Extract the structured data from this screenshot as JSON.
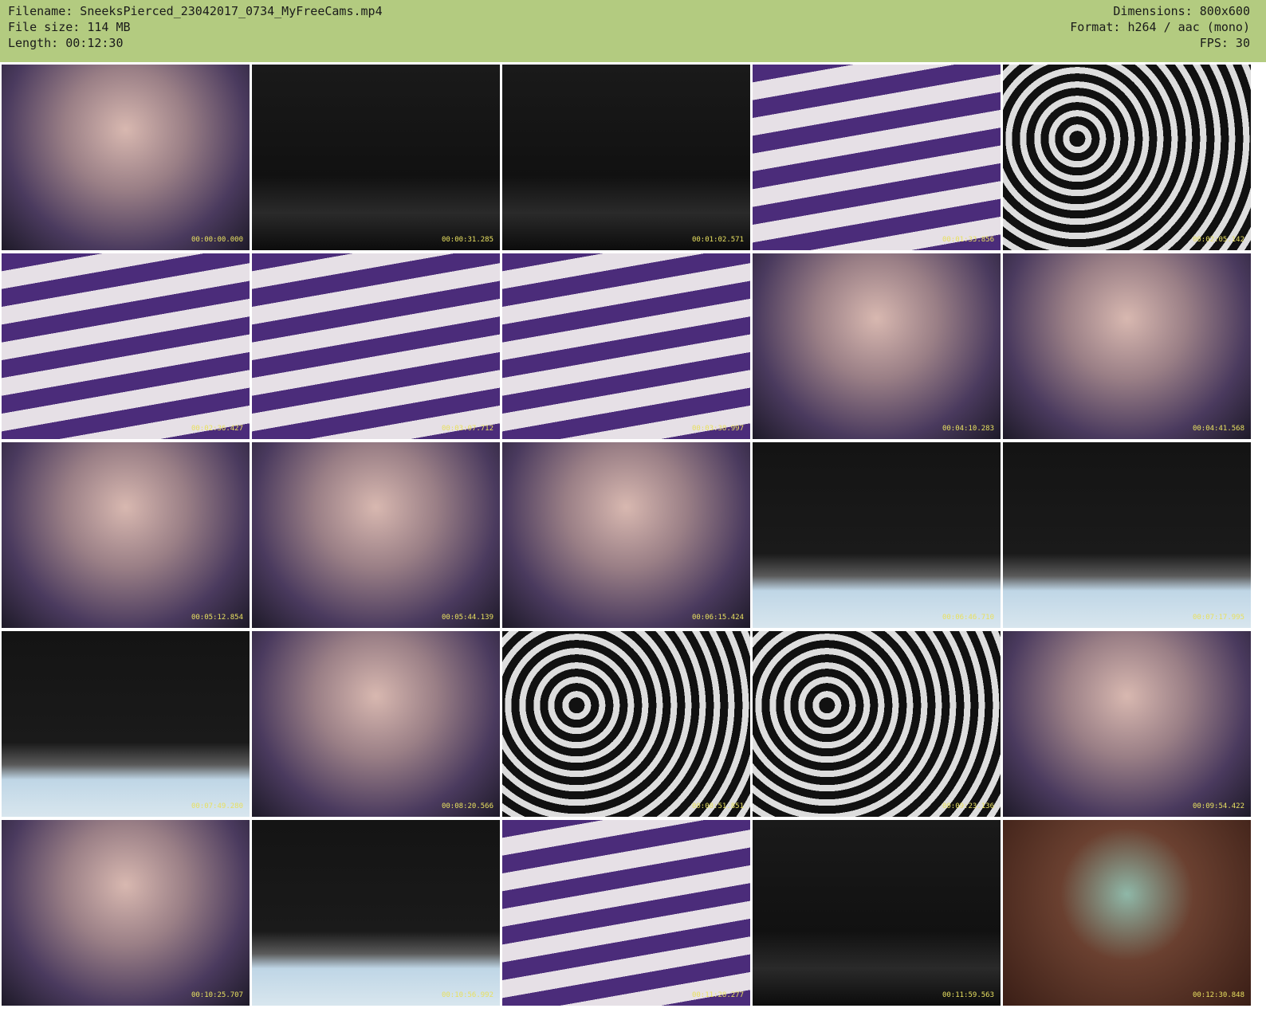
{
  "header": {
    "filename_label": "Filename: SneeksPierced_23042017_0734_MyFreeCams.mp4",
    "filesize_label": "File size: 114 MB",
    "length_label": "Length: 00:12:30",
    "dimensions_label": "Dimensions: 800x600",
    "format_label": "Format: h264 / aac (mono)",
    "fps_label": "FPS: 30"
  },
  "colors": {
    "header_bg": "#b3cb80",
    "timestamp": "#e8e060"
  },
  "thumbnails": [
    {
      "time": "00:00:00.000",
      "style": "warm"
    },
    {
      "time": "00:00:31.285",
      "style": "dark"
    },
    {
      "time": "00:01:02.571",
      "style": "dark"
    },
    {
      "time": "00:01:33.856",
      "style": "stripe"
    },
    {
      "time": "00:02:05.142",
      "style": "pattern"
    },
    {
      "time": "00:02:36.427",
      "style": "stripe"
    },
    {
      "time": "00:03:07.712",
      "style": "stripe"
    },
    {
      "time": "00:03:38.997",
      "style": "stripe"
    },
    {
      "time": "00:04:10.283",
      "style": "warm"
    },
    {
      "time": "00:04:41.568",
      "style": "warm"
    },
    {
      "time": "00:05:12.854",
      "style": "warm"
    },
    {
      "time": "00:05:44.139",
      "style": "warm"
    },
    {
      "time": "00:06:15.424",
      "style": "warm"
    },
    {
      "time": "00:06:46.710",
      "style": "light"
    },
    {
      "time": "00:07:17.995",
      "style": "light"
    },
    {
      "time": "00:07:49.280",
      "style": "light"
    },
    {
      "time": "00:08:20.566",
      "style": "warm"
    },
    {
      "time": "00:08:51.851",
      "style": "pattern"
    },
    {
      "time": "00:09:23.136",
      "style": "pattern"
    },
    {
      "time": "00:09:54.422",
      "style": "warm"
    },
    {
      "time": "00:10:25.707",
      "style": "warm"
    },
    {
      "time": "00:10:56.992",
      "style": "light"
    },
    {
      "time": "00:11:28.277",
      "style": "stripe"
    },
    {
      "time": "00:11:59.563",
      "style": "dark"
    },
    {
      "time": "00:12:30.848",
      "style": "brown"
    }
  ]
}
